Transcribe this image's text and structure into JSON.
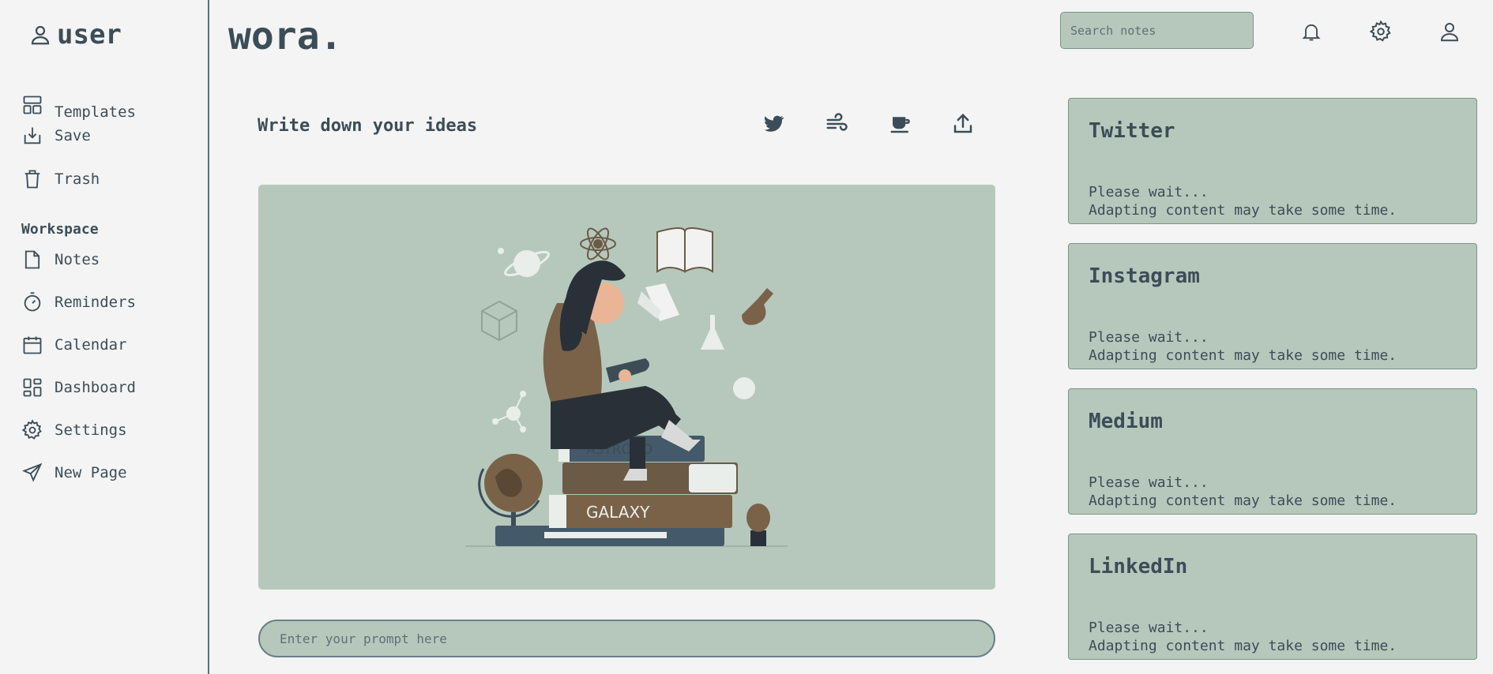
{
  "sidebar": {
    "user_label": "user",
    "items": [
      {
        "label": "Templates",
        "icon": "layout-icon"
      },
      {
        "label": "Save",
        "icon": "download-icon"
      },
      {
        "label": "Trash",
        "icon": "trash-icon"
      }
    ],
    "workspace_label": "Workspace",
    "workspace_items": [
      {
        "label": "Notes",
        "icon": "file-icon"
      },
      {
        "label": "Reminders",
        "icon": "stopwatch-icon"
      },
      {
        "label": "Calendar",
        "icon": "calendar-icon"
      },
      {
        "label": "Dashboard",
        "icon": "dashboard-icon"
      },
      {
        "label": "Settings",
        "icon": "gear-icon"
      },
      {
        "label": "New Page",
        "icon": "send-icon"
      }
    ]
  },
  "header": {
    "brand": "wora.",
    "search_placeholder": "Search notes"
  },
  "main": {
    "title": "Write down your ideas",
    "tools": [
      "twitter-icon",
      "wind-icon",
      "coffee-icon",
      "share-icon"
    ],
    "illustration": {
      "book_top": "ASTRONO",
      "book_bottom": "GALAXY"
    },
    "prompt_placeholder": "Enter your prompt here"
  },
  "cards": [
    {
      "title": "Twitter",
      "line1": "Please wait...",
      "line2": "Adapting content may take some time."
    },
    {
      "title": "Instagram",
      "line1": "Please wait...",
      "line2": "Adapting content may take some time."
    },
    {
      "title": "Medium",
      "line1": "Please wait...",
      "line2": "Adapting content may take some time."
    },
    {
      "title": "LinkedIn",
      "line1": "Please wait...",
      "line2": "Adapting content may take some time."
    }
  ],
  "colors": {
    "background": "#f4f4f4",
    "panel": "#b6c8bc",
    "text": "#3c4d58",
    "accent_brown": "#6b5a45"
  }
}
